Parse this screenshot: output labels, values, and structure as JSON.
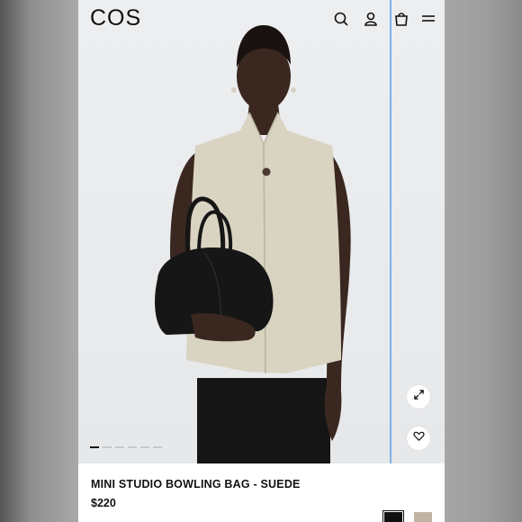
{
  "header": {
    "logo": "COS",
    "icons": [
      "search-icon",
      "account-icon",
      "bag-icon",
      "menu-icon"
    ]
  },
  "gallery": {
    "slide_count": 6,
    "active_slide": 1,
    "expand_icon": "expand-icon",
    "wishlist_icon": "heart-icon"
  },
  "product": {
    "name": "MINI STUDIO BOWLING BAG - SUEDE",
    "price": "$220"
  },
  "swatches": [
    {
      "name": "black",
      "color": "#111111",
      "selected": true
    },
    {
      "name": "beige",
      "color": "#bfb3a3",
      "selected": false
    }
  ],
  "colors": {
    "guide_line": "#7fb0e8",
    "vest": "#d9d3c2",
    "bag": "#161616"
  }
}
